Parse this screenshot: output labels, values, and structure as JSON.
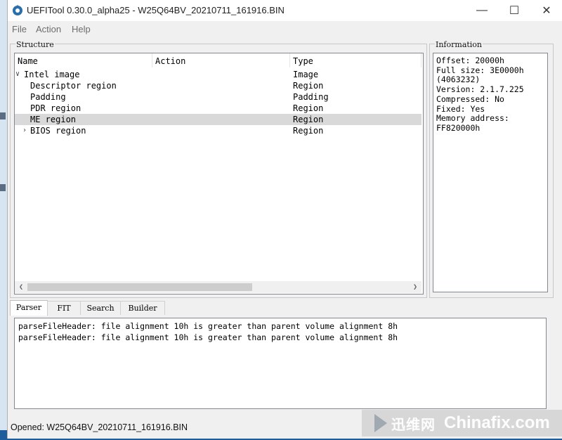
{
  "titlebar": {
    "title": "UEFITool 0.30.0_alpha25 - W25Q64BV_20210711_161916.BIN"
  },
  "window_controls": {
    "minimize": "—",
    "maximize": "☐",
    "close": "✕"
  },
  "menu": [
    "File",
    "Action",
    "Help"
  ],
  "structure": {
    "title": "Structure",
    "columns": [
      "Name",
      "Action",
      "Type"
    ],
    "rows": [
      {
        "name": "Intel image",
        "action": "",
        "type": "Image",
        "expander": "v",
        "selected": false
      },
      {
        "name": "Descriptor region",
        "action": "",
        "type": "Region",
        "expander": "",
        "selected": false
      },
      {
        "name": "Padding",
        "action": "",
        "type": "Padding",
        "expander": "",
        "selected": false
      },
      {
        "name": "PDR region",
        "action": "",
        "type": "Region",
        "expander": "",
        "selected": false
      },
      {
        "name": "ME region",
        "action": "",
        "type": "Region",
        "expander": "",
        "selected": true
      },
      {
        "name": "BIOS region",
        "action": "",
        "type": "Region",
        "expander": ">",
        "selected": false
      }
    ]
  },
  "information": {
    "title": "Information",
    "lines": [
      "Offset: 20000h",
      "Full size: 3E0000h",
      "(4063232)",
      "Version: 2.1.7.225",
      "Compressed: No",
      "Fixed: Yes",
      "Memory address:",
      "FF820000h"
    ]
  },
  "tabs": [
    "Parser",
    "FIT",
    "Search",
    "Builder"
  ],
  "messages": [
    "parseFileHeader: file alignment 10h is greater than parent volume alignment 8h",
    "parseFileHeader: file alignment 10h is greater than parent volume alignment 8h"
  ],
  "status": {
    "text": "Opened: W25Q64BV_20210711_161916.BIN"
  },
  "watermark": {
    "cn": "迅维网",
    "en": "Chinafix.com"
  },
  "colors": {
    "selection": "#d9d9d9",
    "accent": "#1d5d9c"
  }
}
